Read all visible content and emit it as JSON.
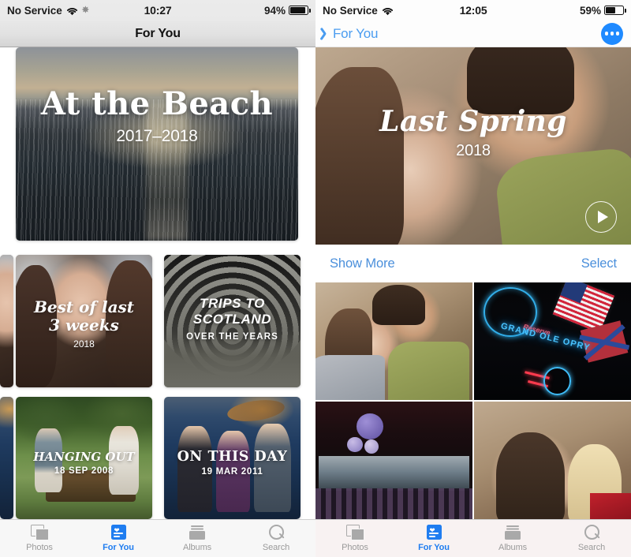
{
  "left_screen": {
    "status_bar": {
      "carrier": "No Service",
      "wifi_icon": "wifi-icon",
      "activity_icon": "activity-spinner-icon",
      "time": "10:27",
      "battery_percent": "94%",
      "battery_level": 94
    },
    "nav_bar": {
      "title": "For You"
    },
    "hero_card": {
      "name": "At the Beach",
      "title": "At the Beach",
      "subtitle": "2017–2018"
    },
    "cards": [
      {
        "title_line1": "Best of last",
        "title_line2": "3 weeks",
        "subtitle": "2018",
        "style": "script"
      },
      {
        "title_line1": "TRIPS TO",
        "title_line2": "SCOTLAND",
        "subtitle": "OVER THE YEARS",
        "style": "oblique"
      },
      {
        "title_line1": "HANGING OUT",
        "title_line2": "",
        "subtitle": "18 SEP 2008",
        "style": "script"
      },
      {
        "title_line1": "ON THIS DAY",
        "title_line2": "",
        "subtitle": "19 MAR 2011",
        "style": "serif"
      }
    ],
    "tab_bar": {
      "active": "For You",
      "tabs": [
        {
          "label": "Photos",
          "icon": "photos-icon"
        },
        {
          "label": "For You",
          "icon": "for-you-icon"
        },
        {
          "label": "Albums",
          "icon": "albums-icon"
        },
        {
          "label": "Search",
          "icon": "search-icon"
        }
      ]
    }
  },
  "right_screen": {
    "status_bar": {
      "carrier": "No Service",
      "wifi_icon": "wifi-icon",
      "time": "12:05",
      "battery_percent": "59%",
      "battery_level": 59
    },
    "nav_bar": {
      "back_label": "For You",
      "back_icon": "chevron-left-icon",
      "more_button_icon": "ellipsis-icon"
    },
    "memory_hero": {
      "title": "Last Spring",
      "subtitle": "2018",
      "play_icon": "play-icon"
    },
    "action_bar": {
      "show_more": "Show More",
      "select": "Select"
    },
    "photo_grid": [
      {
        "name": "couple-selfie"
      },
      {
        "name": "grand-ole-opry-neon-sign",
        "neon_main": "GRAND OLE OPRY",
        "neon_script": "Reserve"
      },
      {
        "name": "venue-stage-balloons"
      },
      {
        "name": "two-women-selfie"
      }
    ],
    "tab_bar": {
      "active": "For You",
      "tabs": [
        {
          "label": "Photos",
          "icon": "photos-icon"
        },
        {
          "label": "For You",
          "icon": "for-you-icon"
        },
        {
          "label": "Albums",
          "icon": "albums-icon"
        },
        {
          "label": "Search",
          "icon": "search-icon"
        }
      ]
    }
  },
  "colors": {
    "accent_blue": "#1f7df0",
    "link_blue": "#4a8fdb",
    "tab_inactive": "#9a9a9a"
  }
}
